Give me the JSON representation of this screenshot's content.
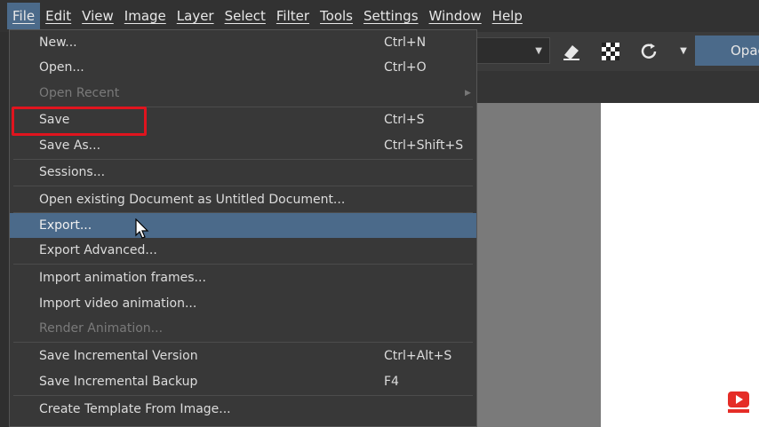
{
  "menubar": {
    "items": [
      "File",
      "Edit",
      "View",
      "Image",
      "Layer",
      "Select",
      "Filter",
      "Tools",
      "Settings",
      "Window",
      "Help"
    ]
  },
  "toolbar": {
    "dropdown_icon": "chevron-down-icon",
    "icons": [
      "eraser-icon",
      "checker-icon",
      "refresh-icon",
      "chevron-down-icon"
    ],
    "opacity_label": "Opac"
  },
  "file_menu": {
    "new": {
      "label": "New...",
      "shortcut": "Ctrl+N"
    },
    "open": {
      "label": "Open...",
      "shortcut": "Ctrl+O"
    },
    "open_recent": {
      "label": "Open Recent"
    },
    "save": {
      "label": "Save",
      "shortcut": "Ctrl+S"
    },
    "save_as": {
      "label": "Save As...",
      "shortcut": "Ctrl+Shift+S"
    },
    "sessions": {
      "label": "Sessions..."
    },
    "open_existing": {
      "label": "Open existing Document as Untitled Document..."
    },
    "export": {
      "label": "Export..."
    },
    "export_advanced": {
      "label": "Export Advanced..."
    },
    "import_frames": {
      "label": "Import animation frames..."
    },
    "import_video": {
      "label": "Import video animation..."
    },
    "render_animation": {
      "label": "Render Animation..."
    },
    "save_incremental_version": {
      "label": "Save Incremental Version",
      "shortcut": "Ctrl+Alt+S"
    },
    "save_incremental_backup": {
      "label": "Save Incremental Backup",
      "shortcut": "F4"
    },
    "create_template": {
      "label": "Create Template From Image..."
    }
  },
  "colors": {
    "accent": "#4b6a8a",
    "highlight_box": "#e0141e",
    "menu_bg": "#383838"
  }
}
